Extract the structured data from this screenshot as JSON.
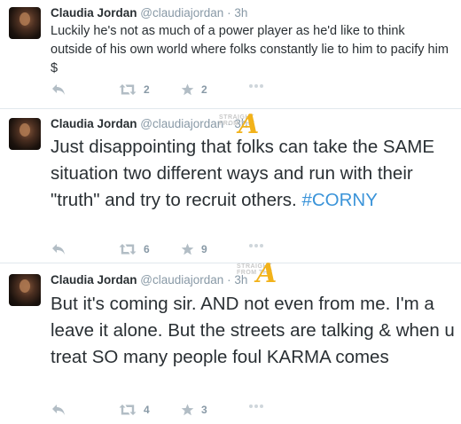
{
  "tweets": [
    {
      "name": "Claudia Jordan",
      "handle": "@claudiajordan",
      "dot": "·",
      "time": "3h",
      "text": "Luckily he's not as much of a power player as he'd like to think outside of his own world where folks constantly lie to him to pacify him $",
      "hashtag": "",
      "retweets": "2",
      "favorites": "2"
    },
    {
      "name": "Claudia Jordan",
      "handle": "@claudiajordan",
      "dot": "·",
      "time": "3h",
      "text": "Just disappointing that folks can take the SAME situation two different ways and run with their \"truth\" and try to recruit others.",
      "hashtag": "#CORNY",
      "retweets": "6",
      "favorites": "9"
    },
    {
      "name": "Claudia Jordan",
      "handle": "@claudiajordan",
      "dot": "·",
      "time": "3h",
      "text": "But it's coming sir. AND not even from me. I'm a leave it alone. But the streets are talking & when u treat SO many people foul KARMA comes",
      "hashtag": "",
      "retweets": "4",
      "favorites": "3"
    }
  ],
  "watermark": {
    "small_text": "STRAIGHT FROM THE",
    "letter": "A",
    "color": "#f2b21a"
  },
  "icons": {
    "reply": "reply-arrow-icon",
    "retweet": "retweet-icon",
    "favorite": "star-icon",
    "more": "more-dots-icon"
  },
  "colors": {
    "name": "#292f33",
    "meta": "#8899a6",
    "hashtag": "#3b94d9",
    "divider": "#e1e8ed"
  }
}
